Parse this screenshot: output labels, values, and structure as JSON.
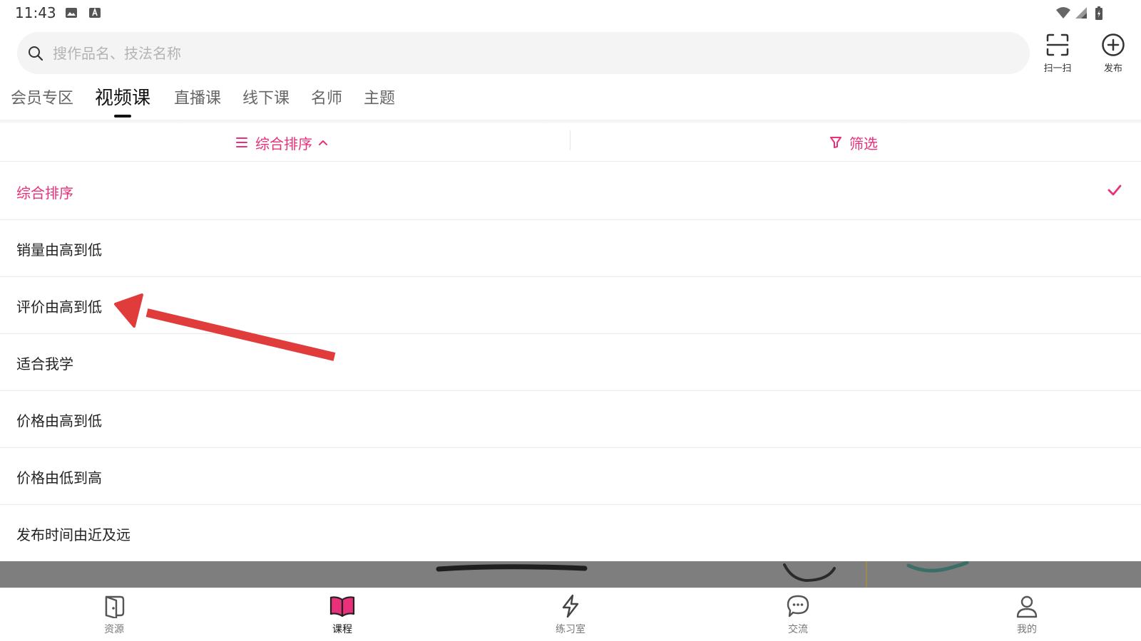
{
  "status_bar": {
    "time": "11:43"
  },
  "search": {
    "placeholder": "搜作品名、技法名称"
  },
  "top_actions": {
    "scan_label": "扫一扫",
    "publish_label": "发布"
  },
  "tabs": [
    {
      "label": "会员专区",
      "active": false
    },
    {
      "label": "视频课",
      "active": true
    },
    {
      "label": "直播课",
      "active": false
    },
    {
      "label": "线下课",
      "active": false
    },
    {
      "label": "名师",
      "active": false
    },
    {
      "label": "主题",
      "active": false
    }
  ],
  "sort_bar": {
    "sort_label": "综合排序",
    "filter_label": "筛选"
  },
  "sort_options": [
    {
      "label": "综合排序",
      "selected": true
    },
    {
      "label": "销量由高到低",
      "selected": false
    },
    {
      "label": "评价由高到低",
      "selected": false
    },
    {
      "label": "适合我学",
      "selected": false
    },
    {
      "label": "价格由高到低",
      "selected": false
    },
    {
      "label": "价格由低到高",
      "selected": false
    },
    {
      "label": "发布时间由近及远",
      "selected": false
    }
  ],
  "bottom_nav": [
    {
      "label": "资源",
      "icon": "resource-icon",
      "active": false
    },
    {
      "label": "课程",
      "icon": "book-icon",
      "active": true
    },
    {
      "label": "练习室",
      "icon": "lightning-icon",
      "active": false
    },
    {
      "label": "交流",
      "icon": "chat-icon",
      "active": false
    },
    {
      "label": "我的",
      "icon": "person-icon",
      "active": false
    }
  ],
  "colors": {
    "accent": "#e8317a",
    "annotation_arrow": "#e03c3c"
  }
}
